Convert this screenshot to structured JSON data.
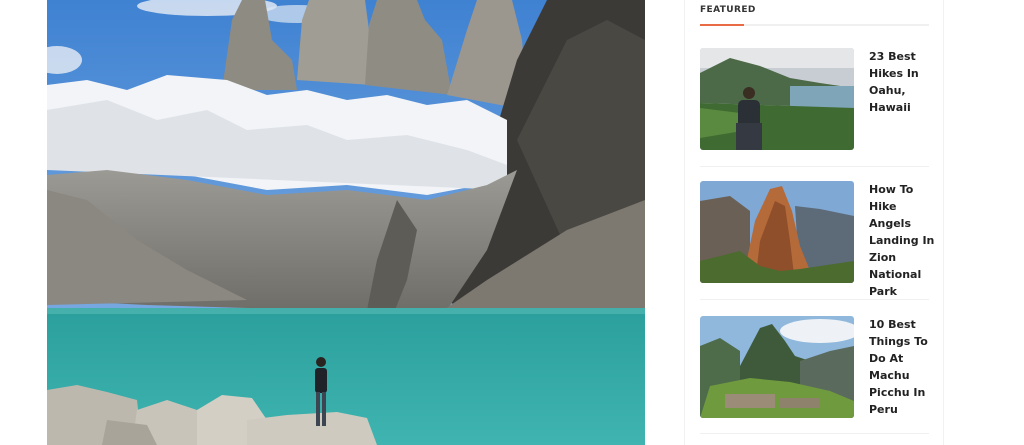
{
  "sidebar": {
    "heading": "FEATURED",
    "accent_color": "#e96b46",
    "posts": [
      {
        "title": "23 Best Hikes In Oahu, Hawaii",
        "thumbnail": "hawaii-hiker-photo"
      },
      {
        "title": "How To Hike Angels Landing In Zion National Park",
        "thumbnail": "zion-angels-landing-photo"
      },
      {
        "title": "10 Best Things To Do At Machu Picchu In Peru",
        "thumbnail": "machu-picchu-photo"
      }
    ]
  },
  "hero": {
    "image": "torres-del-paine-lake-photo",
    "colors": {
      "sky": "#4f8fd6",
      "lake": "#36a9a5",
      "rock": "#7a7a74"
    }
  }
}
